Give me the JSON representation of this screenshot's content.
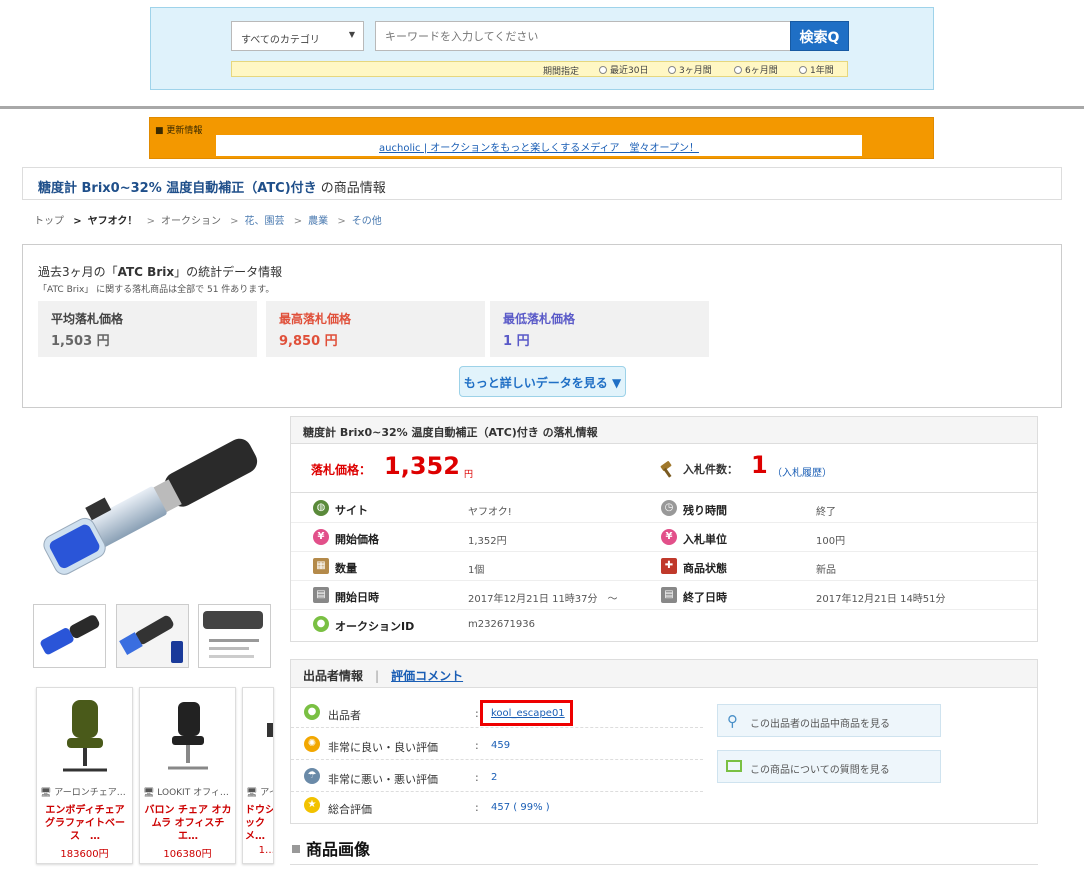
{
  "search": {
    "category": "すべてのカテゴリ",
    "placeholder": "キーワードを入力してください",
    "button": "検索",
    "period_label": "期間指定",
    "periods": [
      "最近30日",
      "3ヶ月間",
      "6ヶ月間",
      "1年間"
    ]
  },
  "news": {
    "label": "■ 更新情報",
    "text": "aucholic | オークションをもっと楽しくするメディア　堂々オープン！"
  },
  "title": {
    "product": "糖度計 Brix0~32% 温度自動補正（ATC)付き",
    "suffix": " の商品情報"
  },
  "breadcrumb": [
    "トップ",
    "ヤフオク！",
    "オークション",
    "花、園芸",
    "農業",
    "その他"
  ],
  "stats": {
    "title_prefix": "過去3ヶ月の「",
    "keyword": "ATC Brix",
    "title_suffix": "」の統計データ情報",
    "subtitle": "「ATC Brix」 に関する落札商品は全部で 51 件あります。",
    "cards": [
      {
        "label": "平均落札価格",
        "value": "1,503 円",
        "color": "#444444"
      },
      {
        "label": "最高落札価格",
        "value": "9,850 円",
        "color": "#e0503a"
      },
      {
        "label": "最低落札価格",
        "value": "1 円",
        "color": "#5a5ac8"
      }
    ],
    "more_button": "もっと詳しいデータを見る ▼"
  },
  "auction": {
    "header": "糖度計 Brix0~32% 温度自動補正（ATC)付き の落札情報",
    "price_label": "落札価格：",
    "price": "1,352",
    "price_unit": "円",
    "bids_label": "入札件数：",
    "bids": "1",
    "bids_history": "（入札履歴）",
    "rows": [
      {
        "k1": "サイト",
        "v1": "ヤフオク!",
        "k2": "残り時間",
        "v2": "終了"
      },
      {
        "k1": "開始価格",
        "v1": "1,352円",
        "k2": "入札単位",
        "v2": "100円"
      },
      {
        "k1": "数量",
        "v1": "1個",
        "k2": "商品状態",
        "v2": "新品"
      },
      {
        "k1": "開始日時",
        "v1": "2017年12月21日 11時37分　～",
        "k2": "終了日時",
        "v2": "2017年12月21日 14時51分"
      },
      {
        "k1": "オークションID",
        "v1": "m232671936"
      }
    ]
  },
  "seller": {
    "tab_info": "出品者情報",
    "tab_comment": "評価コメント",
    "rows": [
      {
        "label": "出品者",
        "value": "kool_escape01"
      },
      {
        "label": "非常に良い・良い評価",
        "value": "459"
      },
      {
        "label": "非常に悪い・悪い評価",
        "value": "2"
      },
      {
        "label": "総合評価",
        "value": "457 ( 99% )"
      }
    ],
    "btn_items": "この出品者の出品中商品を見る",
    "btn_question": "この商品についての質問を見る"
  },
  "recommend": [
    {
      "name": "アーロンチェア…",
      "title": "エンボディチェア グラファイトベース　…",
      "price": "183600円"
    },
    {
      "name": "LOOKIT オフィ…",
      "title": "バロン チェア オカムラ オフィスチエ…",
      "price": "106380円"
    },
    {
      "name": "アイ…",
      "title": "ドウシックメ…",
      "price": "1…"
    }
  ],
  "image_section": "商品画像"
}
